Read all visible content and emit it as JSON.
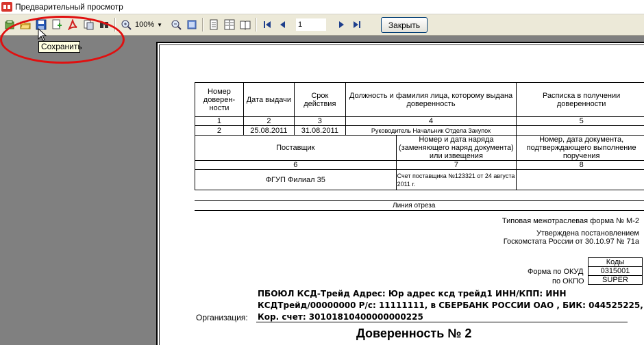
{
  "window": {
    "title": "Предварительный просмотр"
  },
  "toolbar": {
    "zoom": "100%",
    "page_number": "1",
    "close_label": "Закрыть",
    "tooltip": "Сохранить",
    "icons": [
      "new-icon",
      "open-folder-icon",
      "save-icon",
      "export-icon",
      "pdf-icon",
      "print-setup-icon",
      "find-icon",
      "zoom-in-icon",
      "zoom-out-icon",
      "whole-page-icon",
      "single-page-icon",
      "multi-page-icon",
      "book-icon",
      "first-page-icon",
      "prev-page-icon",
      "next-page-icon",
      "last-page-icon"
    ]
  },
  "document": {
    "table": {
      "h1": "Номер доверен-ности",
      "h2": "Дата выдачи",
      "h3": "Срок действия",
      "h4": "Должность и фамилия лица, которому выдана доверенность",
      "h5": "Расписка в получении доверенности",
      "n1": "1",
      "n2": "2",
      "n3": "3",
      "n4": "4",
      "n5": "5",
      "v1": "2",
      "v2": "25.08.2011",
      "v3": "31.08.2011",
      "v4": "Руководитель  Начальник Отдела Закупок",
      "v5": "",
      "h6": "Поставщик",
      "h7": "Номер и дата наряда (заменяющего наряд документа) или извещения",
      "h8": "Номер, дата документа, подтверждающего выполнение поручения",
      "n6": "6",
      "n7": "7",
      "n8": "8",
      "v6": "ФГУП Филиал 35",
      "v7": "Счет поставщика №123321 от 24 августа 2011 г.",
      "v8": ""
    },
    "cut_line": "Линия отреза",
    "form_type": "Типовая межотраслевая форма № М-2",
    "approved_1": "Утверждена постановлением",
    "approved_2": "Госкомстата России от 30.10.97 № 71а",
    "codes_header": "Коды",
    "okud_label": "Форма по ОКУД",
    "okud_value": "0315001",
    "okpo_label": "по ОКПО",
    "okpo_value": "SUPER",
    "org_label": "Организация:",
    "org_line1": "ПБОЮЛ  КСД-Трейд Адрес: Юр адрес ксд трейд1 ИНН/КПП: ИНН",
    "org_line2": "КСДТрейд/00000000 Р/с: 11111111, в СБЕРБАНК РОССИИ ОАО , БИК: 044525225,",
    "org_line3": "Кор. счет: 30101810400000000225",
    "doc_title": "Доверенность № 2"
  },
  "colors": {
    "highlight_oval": "#e01010",
    "workspace": "#808080",
    "toolbar": "#ece9d8"
  }
}
